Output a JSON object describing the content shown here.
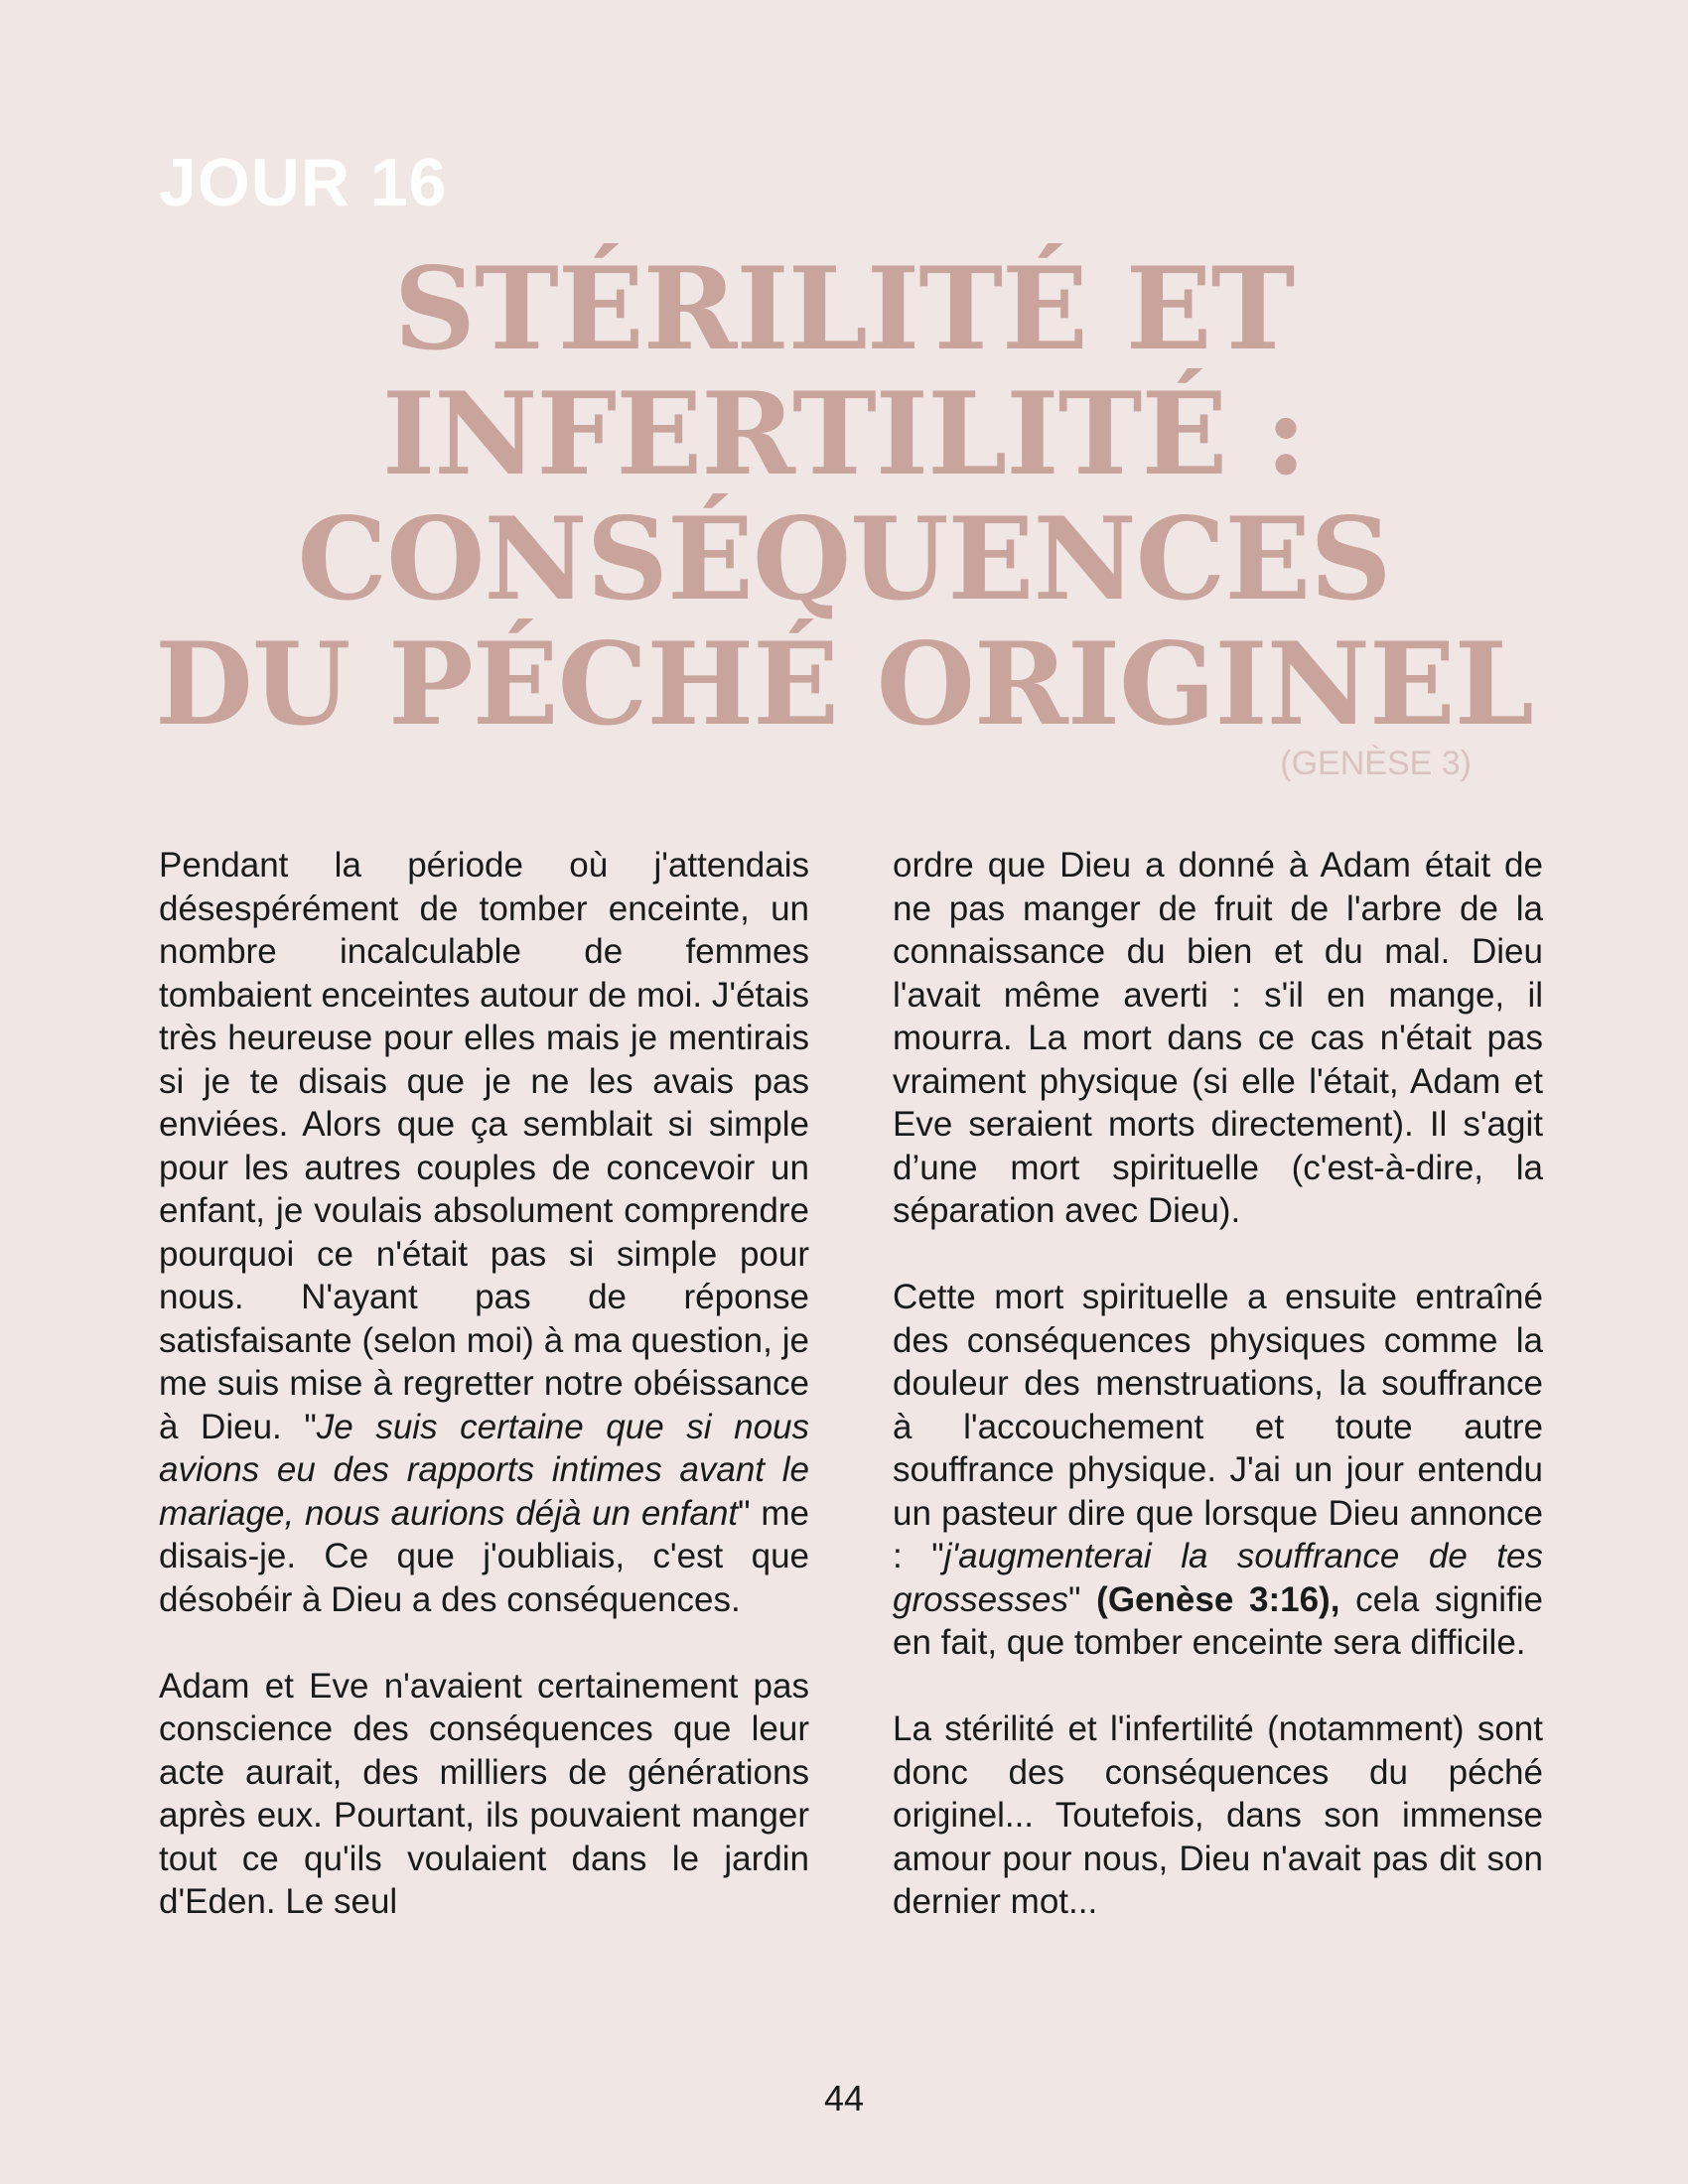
{
  "header": {
    "day_label": "JOUR 16",
    "title_lines": [
      "STÉRILITÉ ET",
      "INFERTILITÉ :",
      "CONSÉQUENCES",
      "DU PÉCHÉ ORIGINEL"
    ],
    "reference": "(GENÈSE 3)"
  },
  "body": {
    "left": {
      "p1_a": "Pendant la période où j'attendais désespérément de tomber enceinte, un nombre incalculable de femmes tombaient enceintes autour de moi. J'étais très heureuse pour elles mais je mentirais si je te disais que je ne les avais pas enviées. Alors que ça semblait si simple pour les autres couples de concevoir un enfant, je voulais absolument comprendre pourquoi ce n'était pas si simple pour nous. N'ayant pas de réponse satisfaisante (selon moi) à ma question, je me suis mise à regretter notre obéissance à Dieu. \"",
      "p1_quote": "Je suis certaine que si nous avions eu des rapports intimes avant le mariage, nous aurions déjà un enfant",
      "p1_b": "\" me disais-je. Ce que j'oubliais, c'est que désobéir à Dieu a des conséquences.",
      "p2": "Adam et Eve n'avaient certainement pas conscience des conséquences que leur acte aurait, des milliers de générations après eux. Pourtant, ils pouvaient manger tout ce qu'ils voulaient dans le jardin d'Eden. Le seul"
    },
    "right": {
      "p1": "ordre que Dieu a donné à Adam était de ne pas manger de fruit de l'arbre de la connaissance du bien et du mal. Dieu l'avait même averti : s'il en mange, il mourra. La mort dans ce cas n'était pas vraiment physique (si elle l'était, Adam et Eve seraient morts directement). Il s'agit d’une mort spirituelle (c'est-à-dire, la séparation avec Dieu).",
      "p2_a": "Cette mort spirituelle a ensuite entraîné des conséquences physiques comme la douleur des menstruations, la souffrance à l'accouchement et toute autre souffrance physique. J'ai un jour entendu un pasteur dire que lorsque Dieu annonce : \"",
      "p2_quote": "j'augmenterai la souffrance de tes grossesses",
      "p2_b": "\" ",
      "p2_ref": "(Genèse 3:16),",
      "p2_c": " cela signifie en fait, que tomber enceinte sera difficile.",
      "p3": "La stérilité et l'infertilité (notamment) sont donc des conséquences du péché originel... Toutefois, dans son immense amour pour nous, Dieu n'avait pas dit son dernier mot..."
    }
  },
  "footer": {
    "page_number": "44"
  },
  "colors": {
    "background": "#f0e6e4",
    "title": "#c9a49c",
    "day_label": "#ffffff",
    "reference": "#d9c3be",
    "text": "#1a1a1a"
  }
}
